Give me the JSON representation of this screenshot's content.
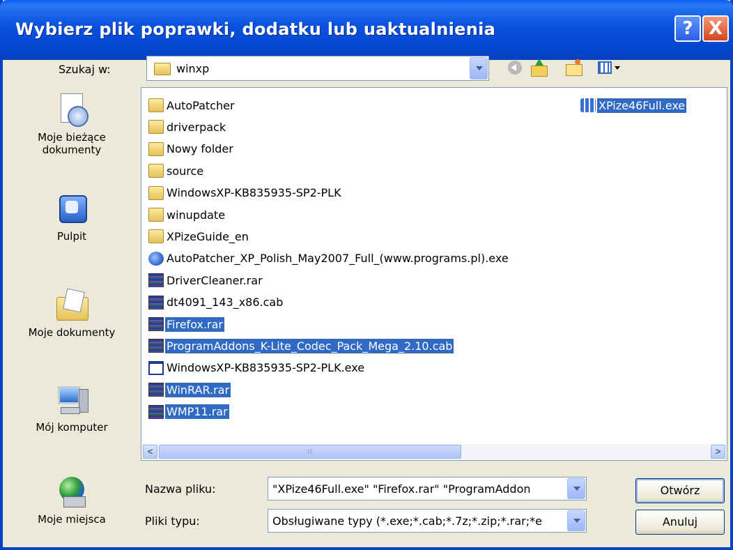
{
  "window": {
    "title": "Wybierz plik poprawki, dodatku lub uaktualnienia",
    "help_label": "?",
    "close_label": "X"
  },
  "lookin": {
    "label": "Szukaj w:",
    "value": "winxp",
    "icon": "folder-icon"
  },
  "toolbar": {
    "icons": [
      "back-icon",
      "up-folder-icon",
      "new-folder-icon",
      "views-menu-icon"
    ]
  },
  "places": [
    {
      "label": "Moje bieżące dokumenty",
      "icon": "recent-documents-icon"
    },
    {
      "label": "Pulpit",
      "icon": "desktop-icon"
    },
    {
      "label": "Moje dokumenty",
      "icon": "my-documents-icon"
    },
    {
      "label": "Mój komputer",
      "icon": "my-computer-icon"
    },
    {
      "label": "Moje miejsca",
      "icon": "network-places-icon"
    }
  ],
  "files": {
    "column1": [
      {
        "name": "AutoPatcher",
        "type": "folder",
        "selected": false
      },
      {
        "name": "driverpack",
        "type": "folder",
        "selected": false
      },
      {
        "name": "Nowy folder",
        "type": "folder",
        "selected": false
      },
      {
        "name": "source",
        "type": "folder",
        "selected": false
      },
      {
        "name": "WindowsXP-KB835935-SP2-PLK",
        "type": "folder",
        "selected": false
      },
      {
        "name": "winupdate",
        "type": "folder",
        "selected": false
      },
      {
        "name": "XPizeGuide_en",
        "type": "folder",
        "selected": false
      },
      {
        "name": "AutoPatcher_XP_Polish_May2007_Full_(www.programs.pl).exe",
        "type": "setup",
        "selected": false
      },
      {
        "name": "DriverCleaner.rar",
        "type": "rar",
        "selected": false
      },
      {
        "name": "dt4091_143_x86.cab",
        "type": "rar",
        "selected": false
      },
      {
        "name": "Firefox.rar",
        "type": "rar",
        "selected": true
      },
      {
        "name": "ProgramAddons_K-Lite_Codec_Pack_Mega_2.10.cab",
        "type": "rar",
        "selected": true
      },
      {
        "name": "WindowsXP-KB835935-SP2-PLK.exe",
        "type": "exe",
        "selected": false
      },
      {
        "name": "WinRAR.rar",
        "type": "rar",
        "selected": true
      },
      {
        "name": "WMP11.rar",
        "type": "rar",
        "selected": true
      }
    ],
    "column2": [
      {
        "name": "XPize46Full.exe",
        "type": "xpize",
        "selected": true
      }
    ]
  },
  "filename": {
    "label": "Nazwa pliku:",
    "value": "\"XPize46Full.exe\" \"Firefox.rar\" \"ProgramAddon"
  },
  "filetype": {
    "label": "Pliki typu:",
    "value": "Obsługiwane typy (*.exe;*.cab;*.7z;*.zip;*.rar;*e"
  },
  "buttons": {
    "open": "Otwórz",
    "cancel": "Anuluj"
  },
  "scrollbar": {
    "left_arrow": "<",
    "right_arrow": ">",
    "grip": "III"
  }
}
